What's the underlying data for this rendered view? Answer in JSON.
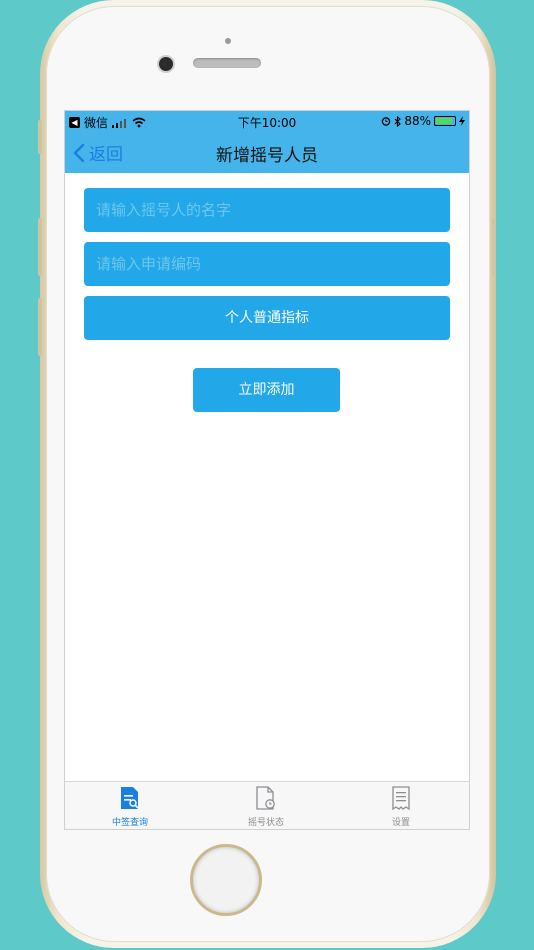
{
  "status_bar": {
    "carrier": "微信",
    "time": "下午10:00",
    "battery": "88%",
    "battery_level": 0.88
  },
  "nav": {
    "back_label": "返回",
    "title": "新增摇号人员"
  },
  "form": {
    "name_placeholder": "请输入摇号人的名字",
    "code_placeholder": "请输入申请编码",
    "quota_type": "个人普通指标",
    "submit_label": "立即添加"
  },
  "tabs": [
    {
      "label": "中签查询",
      "icon": "document-search-icon",
      "active": true
    },
    {
      "label": "摇号状态",
      "icon": "document-clock-icon",
      "active": false
    },
    {
      "label": "设置",
      "icon": "receipt-list-icon",
      "active": false
    }
  ],
  "colors": {
    "background": "#5ec9c9",
    "nav": "#44b4ea",
    "field": "#22a8e8",
    "active_tab": "#1a7fe0",
    "inactive_tab": "#8e8e93"
  }
}
